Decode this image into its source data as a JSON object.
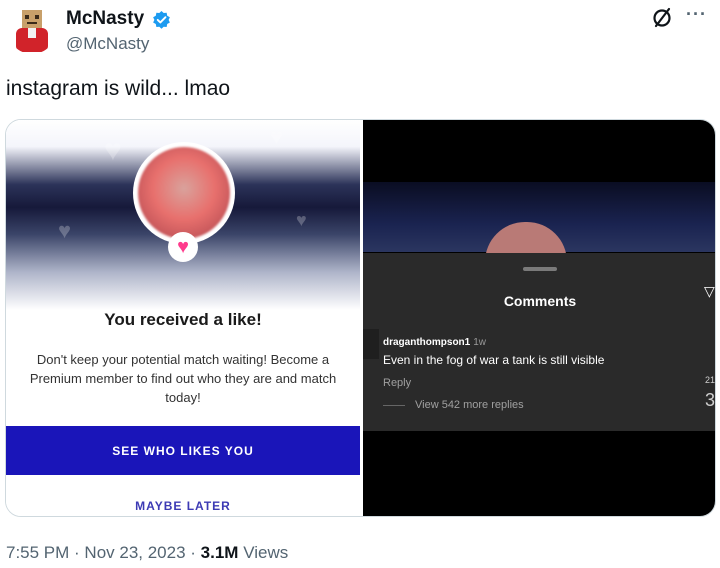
{
  "author": {
    "name": "McNasty",
    "handle": "@McNasty",
    "verified_color": "#1d9bf0"
  },
  "header": {
    "grok_icon": "slashed-circle-icon",
    "more_label": "···"
  },
  "tweet": {
    "text": "instagram is wild... lmao"
  },
  "screenshot_left": {
    "like_title": "You received a like!",
    "like_desc": "Don't keep your potential match waiting! Become a Premium member to find out who they are and match today!",
    "see_button": "SEE WHO LIKES YOU",
    "maybe_later": "MAYBE LATER",
    "accent": "#1a15b9"
  },
  "screenshot_right": {
    "comments_title": "Comments",
    "comment_user": "draganthompson1",
    "comment_time": "1w",
    "comment_text": "Even in the fog of war a tank is still visible",
    "reply_label": "Reply",
    "view_more": "View 542 more replies",
    "side_count": "21",
    "side_mark": "3"
  },
  "footer": {
    "time": "7:55 PM",
    "separator1": " · ",
    "date": "Nov 23, 2023",
    "separator2": " · ",
    "views_count": "3.1M",
    "views_label": " Views"
  }
}
